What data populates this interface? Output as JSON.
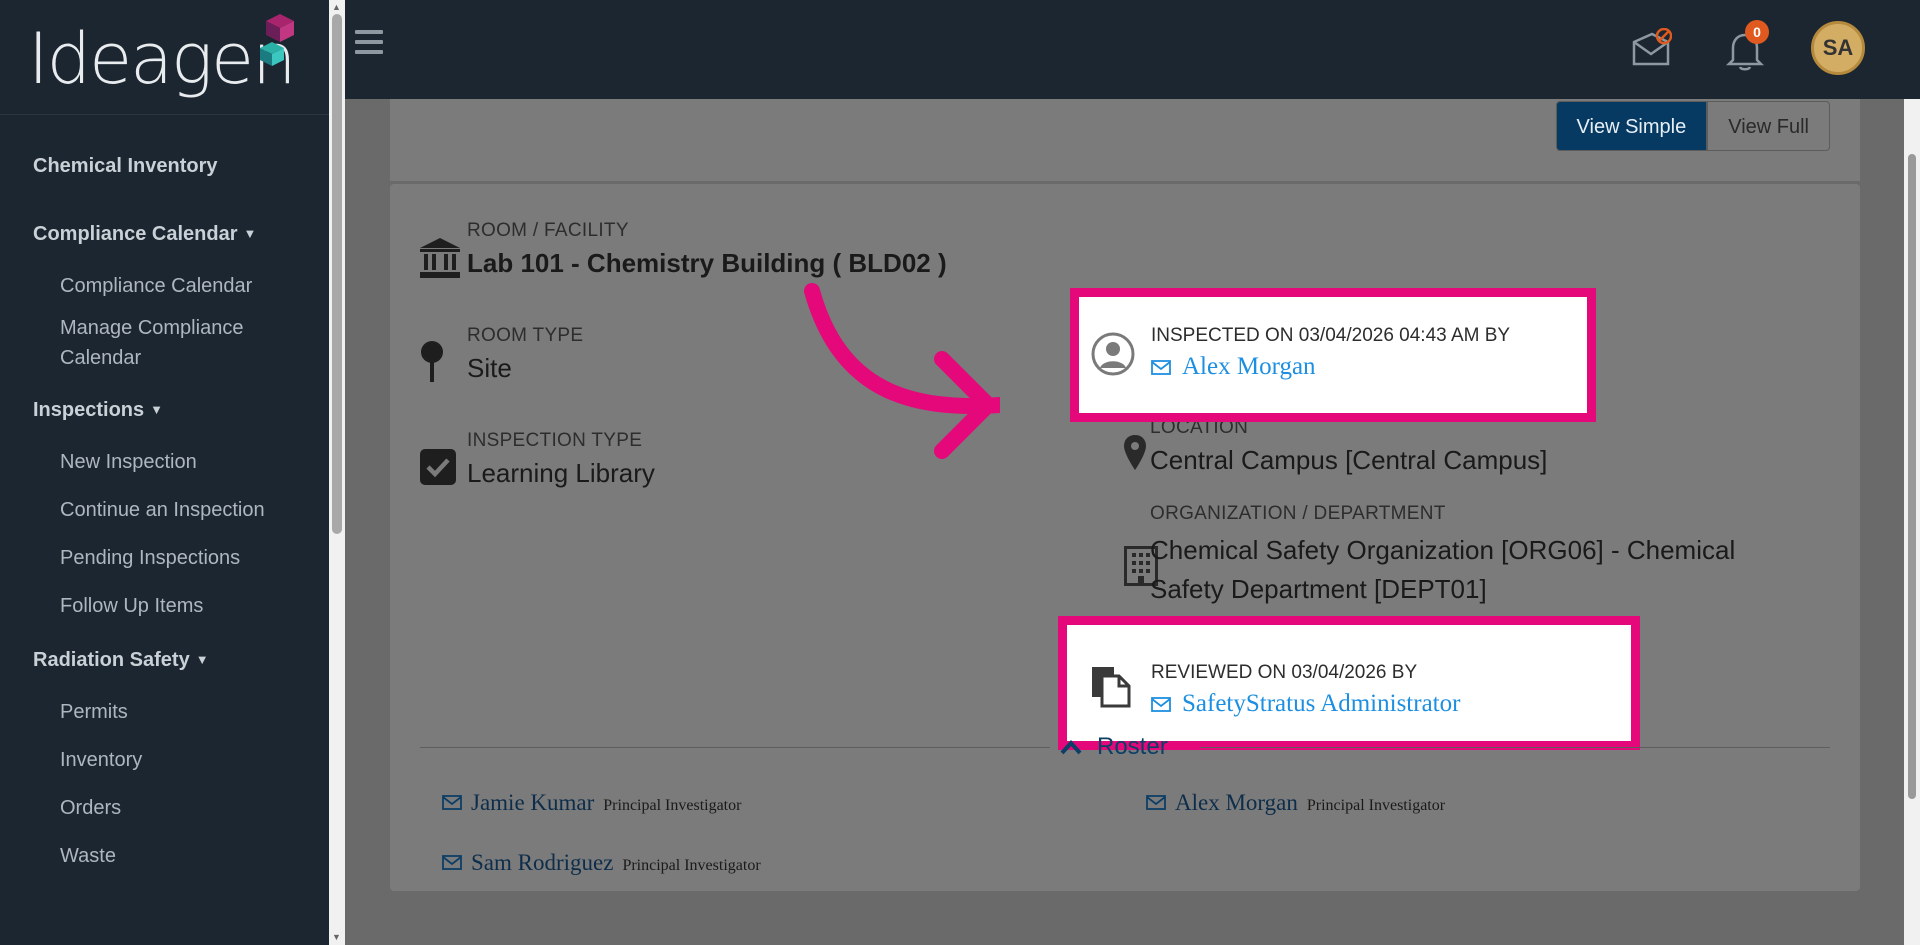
{
  "brand": {
    "logo_text": "Ideagen"
  },
  "sidebar": {
    "sections": [
      {
        "label": "Chemical Inventory",
        "items": []
      },
      {
        "label": "Compliance Calendar",
        "items": [
          "Compliance Calendar",
          "Manage Compliance Calendar"
        ]
      },
      {
        "label": "Inspections",
        "items": [
          "New Inspection",
          "Continue an Inspection",
          "Pending Inspections",
          "Follow Up Items"
        ]
      },
      {
        "label": "Radiation Safety",
        "items": [
          "Permits",
          "Inventory",
          "Orders",
          "Waste"
        ]
      }
    ]
  },
  "header": {
    "notification_count": "0",
    "avatar_initials": "SA"
  },
  "view_toggle": {
    "simple": "View Simple",
    "full": "View Full"
  },
  "details": {
    "room_facility": {
      "label": "ROOM / FACILITY",
      "value": "Lab 101 - Chemistry Building ( BLD02 )"
    },
    "room_type": {
      "label": "ROOM TYPE",
      "value": "Site"
    },
    "inspection_type": {
      "label": "INSPECTION TYPE",
      "value": "Learning Library"
    },
    "inspected": {
      "label": "INSPECTED ON 03/04/2026 04:43 AM BY",
      "person": "Alex Morgan"
    },
    "location": {
      "label": "LOCATION",
      "value": "Central Campus [Central Campus]"
    },
    "organization": {
      "label": "ORGANIZATION / DEPARTMENT",
      "value": "Chemical Safety Organization [ORG06] - Chemical Safety Department [DEPT01]"
    },
    "reviewed": {
      "label": "REVIEWED ON 03/04/2026 BY",
      "person": "SafetyStratus Administrator"
    }
  },
  "roster": {
    "label": "Roster",
    "people": [
      {
        "name": "Jamie Kumar",
        "role": "Principal Investigator"
      },
      {
        "name": "Alex Morgan",
        "role": "Principal Investigator"
      },
      {
        "name": "Sam Rodriguez",
        "role": "Principal Investigator"
      }
    ]
  },
  "colors": {
    "highlight": "#e4087a",
    "link": "#1d8fe0",
    "primary_button": "#063a63",
    "sidebar": "#1b2630"
  },
  "icons": [
    "hamburger-icon",
    "mail-blocked-icon",
    "bell-icon",
    "building-columns-icon",
    "map-pin-icon",
    "check-square-icon",
    "user-circle-icon",
    "location-marker-icon",
    "office-building-icon",
    "documents-icon",
    "envelope-icon",
    "chevron-up-icon"
  ]
}
